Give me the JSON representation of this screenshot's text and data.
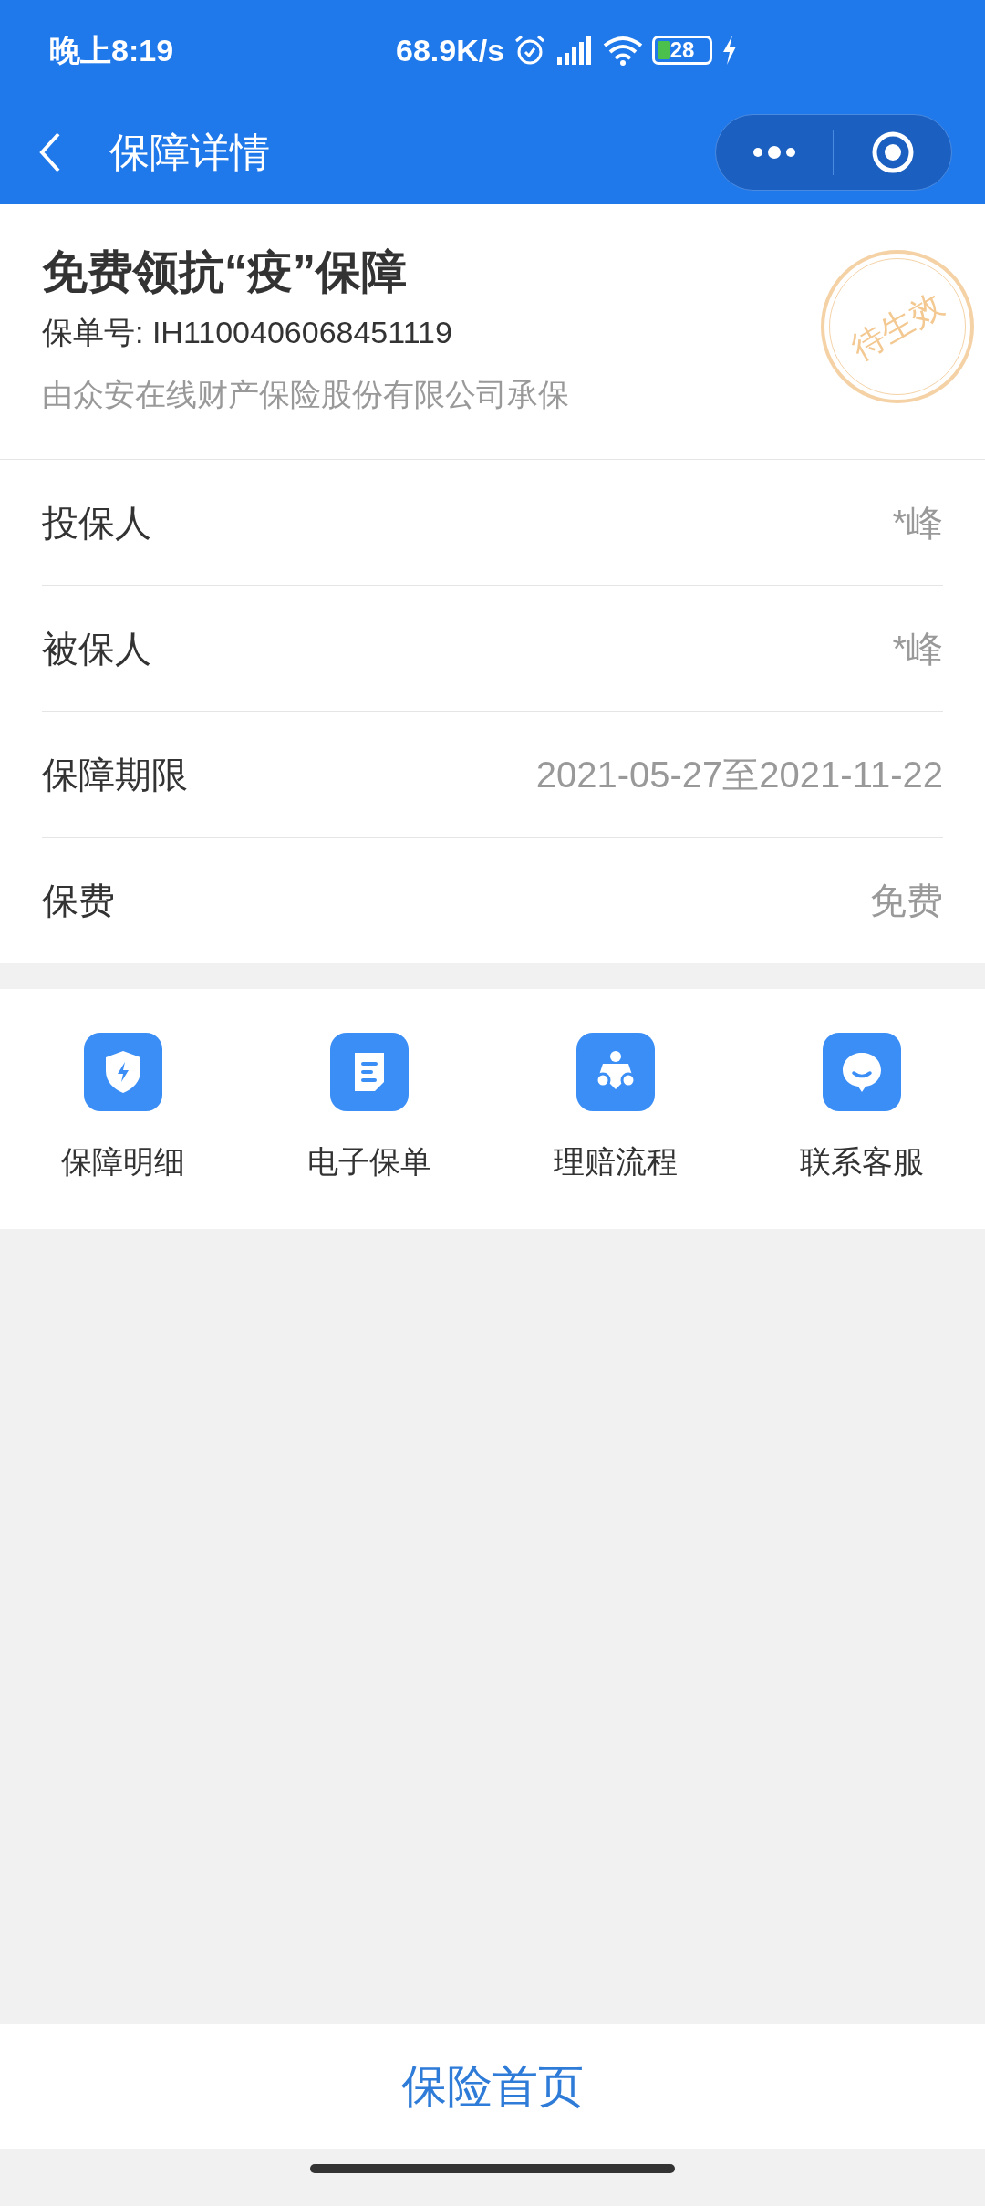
{
  "status_bar": {
    "time": "晚上8:19",
    "net_speed": "68.9K/s",
    "battery": "28"
  },
  "nav": {
    "title": "保障详情"
  },
  "policy": {
    "title": "免费领抗“疫”保障",
    "number": "保单号: IH1100406068451119",
    "insurer": "由众安在线财产保险股份有限公司承保",
    "stamp": "待生效"
  },
  "details": [
    {
      "label": "投保人",
      "value": "*峰"
    },
    {
      "label": "被保人",
      "value": "*峰"
    },
    {
      "label": "保障期限",
      "value": "2021-05-27至2021-11-22"
    },
    {
      "label": "保费",
      "value": "免费"
    }
  ],
  "shortcuts": [
    {
      "kind": "shield",
      "label": "保障明细"
    },
    {
      "kind": "document",
      "label": "电子保单"
    },
    {
      "kind": "people",
      "label": "理赔流程"
    },
    {
      "kind": "chat",
      "label": "联系客服"
    }
  ],
  "bottom_button": "保险首页"
}
